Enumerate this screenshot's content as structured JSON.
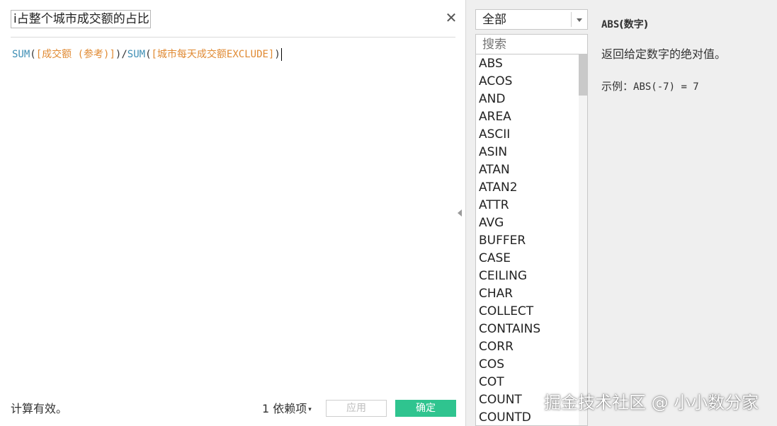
{
  "editor": {
    "calc_name": "i占整个城市成交额的占比",
    "formula": {
      "fn1": "SUM",
      "open1": "(",
      "field1": "[成交额 (参考)]",
      "close1": ")",
      "divide": "/",
      "fn2": "SUM",
      "open2": "(",
      "field2": "[城市每天成交额EXCLUDE]",
      "close2": ")"
    },
    "status": "计算有效。",
    "dependency": "1 依赖项",
    "dependency_arrow": "▾",
    "apply_label": "应用",
    "ok_label": "确定",
    "close_glyph": "✕"
  },
  "functions": {
    "category": "全部",
    "search_placeholder": "搜索",
    "items": [
      "ABS",
      "ACOS",
      "AND",
      "AREA",
      "ASCII",
      "ASIN",
      "ATAN",
      "ATAN2",
      "ATTR",
      "AVG",
      "BUFFER",
      "CASE",
      "CEILING",
      "CHAR",
      "COLLECT",
      "CONTAINS",
      "CORR",
      "COS",
      "COT",
      "COUNT",
      "COUNTD"
    ]
  },
  "help": {
    "title_fn": "ABS",
    "title_args": "(数字)",
    "description": "返回给定数字的绝对值。",
    "example_label": "示例：",
    "example_code": "ABS(-7) = 7"
  },
  "watermark": "掘金技术社区 @ 小小数分家",
  "colors": {
    "function_keyword": "#3f8fb5",
    "field_reference": "#e08a33",
    "ok_button": "#2fc48f",
    "panel_background": "#efefef"
  }
}
